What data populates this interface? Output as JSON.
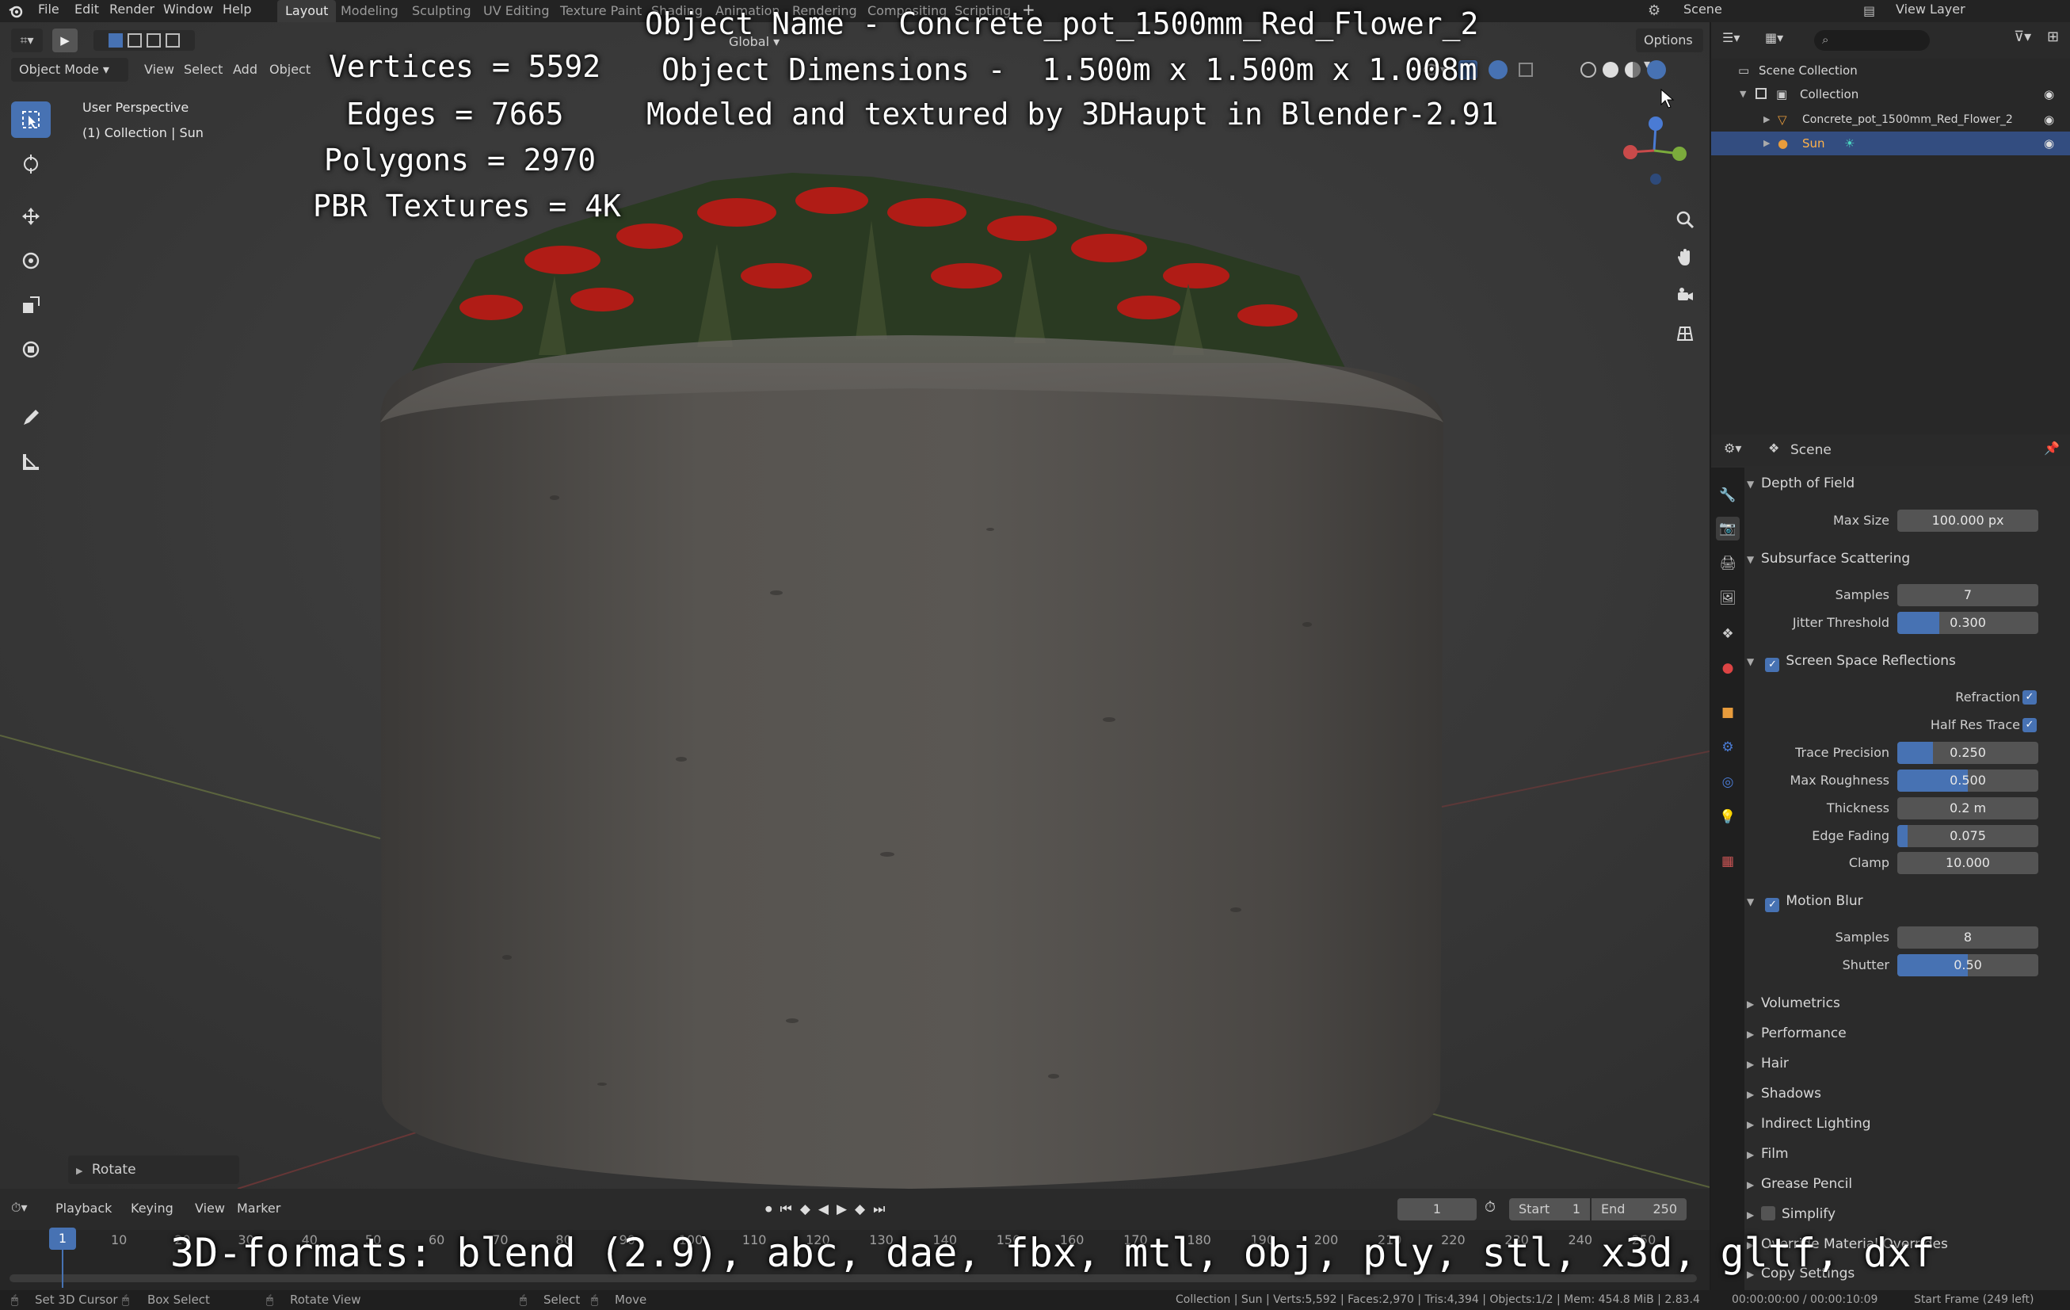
{
  "menubar": {
    "items": [
      "File",
      "Edit",
      "Render",
      "Window",
      "Help"
    ],
    "workspace_tabs": [
      "Layout",
      "Modeling",
      "Sculpting",
      "UV Editing",
      "Texture Paint",
      "Shading",
      "Animation",
      "Rendering",
      "Compositing",
      "Scripting"
    ],
    "active_tab": "Layout",
    "scene_label": "Scene",
    "view_layer_label": "View Layer"
  },
  "viewport_header": {
    "mode": "Object Mode",
    "menus": [
      "View",
      "Select",
      "Add",
      "Object"
    ],
    "orientation": "Global",
    "options": "Options"
  },
  "viewport": {
    "perspective_label": "User Perspective",
    "collection_label": "(1) Collection | Sun",
    "operator_panel": "Rotate"
  },
  "overlay": {
    "object_name": "Object Name - Concrete_pot_1500mm_Red_Flower_2",
    "object_dimensions": "Object Dimensions -  1.500m x 1.500m x 1.008m",
    "credits": "Modeled and textured by 3DHaupt in Blender-2.91",
    "vertices": "Vertices = 5592",
    "edges": "Edges = 7665",
    "polygons": "Polygons = 2970",
    "textures": "PBR Textures = 4K",
    "formats": "3D-formats: blend (2.9), abc, dae, fbx, mtl, obj, ply, stl, x3d, gltf, dxf"
  },
  "outliner": {
    "root": "Scene Collection",
    "collection": "Collection",
    "objects": [
      "Concrete_pot_1500mm_Red_Flower_2",
      "Sun"
    ]
  },
  "properties": {
    "context": "Scene",
    "depth_of_field": {
      "title": "Depth of Field",
      "max_size_label": "Max Size",
      "max_size": "100.000 px"
    },
    "sss": {
      "title": "Subsurface Scattering",
      "samples_label": "Samples",
      "samples": "7",
      "jitter_label": "Jitter Threshold",
      "jitter": "0.300",
      "jitter_fill": 0.3
    },
    "ssr": {
      "title": "Screen Space Reflections",
      "refraction_label": "Refraction",
      "half_res_label": "Half Res Trace",
      "trace_precision_label": "Trace Precision",
      "trace_precision": "0.250",
      "trace_precision_fill": 0.25,
      "max_roughness_label": "Max Roughness",
      "max_roughness": "0.500",
      "max_roughness_fill": 0.5,
      "thickness_label": "Thickness",
      "thickness": "0.2 m",
      "edge_fading_label": "Edge Fading",
      "edge_fading": "0.075",
      "edge_fading_fill": 0.075,
      "clamp_label": "Clamp",
      "clamp": "10.000"
    },
    "motion_blur": {
      "title": "Motion Blur",
      "samples_label": "Samples",
      "samples": "8",
      "shutter_label": "Shutter",
      "shutter": "0.50",
      "shutter_fill": 0.5
    },
    "collapsed": [
      "Volumetrics",
      "Performance",
      "Hair",
      "Shadows",
      "Indirect Lighting",
      "Film",
      "Grease Pencil",
      "Simplify",
      "Override Material Overrides",
      "Copy Settings"
    ]
  },
  "timeline": {
    "menus": [
      "Playback",
      "Keying",
      "View",
      "Marker"
    ],
    "current_frame": "1",
    "start_label": "Start",
    "start": "1",
    "end_label": "End",
    "end": "250",
    "ticks": [
      "10",
      "20",
      "30",
      "40",
      "50",
      "60",
      "70",
      "80",
      "90",
      "100",
      "110",
      "120",
      "130",
      "140",
      "150",
      "160",
      "170",
      "180",
      "190",
      "200",
      "210",
      "220",
      "230",
      "240",
      "250"
    ],
    "playhead": "1"
  },
  "statusbar": {
    "set_cursor": "Set 3D Cursor",
    "box_select": "Box Select",
    "rotate_view": "Rotate View",
    "select": "Select",
    "move": "Move",
    "stats": "Collection | Sun | Verts:5,592 | Faces:2,970 | Tris:4,394 | Objects:1/2 | Mem: 454.8 MiB | 2.83.4",
    "time": "00:00:00:00 / 00:00:10:09",
    "start_frame": "Start Frame (249 left)"
  }
}
